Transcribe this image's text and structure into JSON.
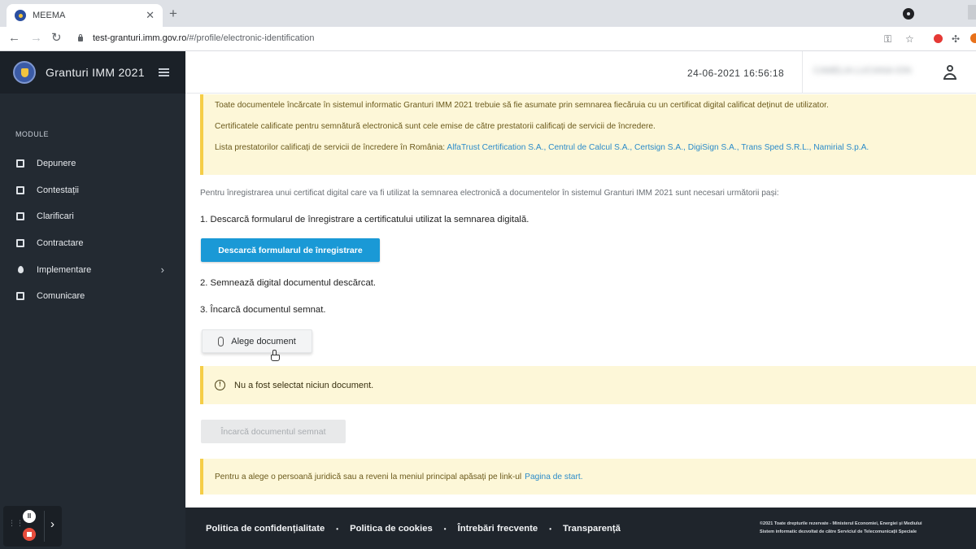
{
  "browser": {
    "tab_title": "MEEMA",
    "tab_close": "✕",
    "new_tab": "+",
    "url_host": "test-granturi.imm.gov.ro",
    "url_path": "/#/profile/electronic-identification",
    "back": "←",
    "forward": "→",
    "reload": "↻"
  },
  "sidebar": {
    "app_name": "Granturi IMM 2021",
    "section_label": "MODULE",
    "items": [
      {
        "label": "Depunere",
        "icon": "inbox-icon"
      },
      {
        "label": "Contestații",
        "icon": "document-icon"
      },
      {
        "label": "Clarificari",
        "icon": "chat-icon"
      },
      {
        "label": "Contractare",
        "icon": "copy-icon"
      },
      {
        "label": "Implementare",
        "icon": "drop-icon",
        "has_submenu": true,
        "chevron": "›"
      },
      {
        "label": "Comunicare",
        "icon": "message-icon"
      }
    ]
  },
  "header": {
    "datetime": "24-06-2021 16:56:18",
    "username": "CAMELIA LUCIANA IONESCU"
  },
  "main": {
    "notice_lines": [
      "Toate documentele încărcate în sistemul informatic Granturi IMM 2021 trebuie să fie asumate prin semnarea fiecăruia cu un certificat digital calificat deținut de utilizator.",
      "Certificatele calificate pentru semnătură electronică sunt cele emise de către prestatorii calificați de servicii de încredere."
    ],
    "providers_prefix": "Lista prestatorilor calificați de servicii de încredere în România:",
    "providers": "AlfaTrust Certification S.A., Centrul de Calcul S.A., Certsign S.A., DigiSign S.A., Trans Sped S.R.L., Namirial S.p.A.",
    "intro": "Pentru înregistrarea unui certificat digital care va fi utilizat la semnarea electronică a documentelor în sistemul Granturi IMM 2021 sunt necesari următorii pași:",
    "step1": "1. Descarcă formularul de înregistrare a certificatului utilizat la semnarea digitală.",
    "download_button": "Descarcă formularul de înregistrare",
    "step2": "2. Semnează digital documentul descărcat.",
    "step3": "3. Încarcă documentul semnat.",
    "choose_button": "Alege document",
    "warning_symbol": "!",
    "warning": "Nu a fost selectat niciun document.",
    "upload_button": "Încarcă documentul semnat",
    "bottom_notice": "Pentru a alege o persoană juridică sau a reveni la meniul principal apăsați pe link-ul",
    "bottom_link": "Pagina de start."
  },
  "footer": {
    "links": [
      "Politica de confidențialitate",
      "Politica de cookies",
      "Întrebări frecvente",
      "Transparență"
    ],
    "separator": "•",
    "copyright_1": "©2021 Toate drepturile rezervate - Ministerul Economiei, Energiei și Mediului",
    "copyright_2": "Sistem informatic dezvoltat de către Serviciul de Telecomunicații Speciale"
  },
  "recorder": {
    "pause": "II",
    "expand": "›",
    "grip": "⋮⋮"
  }
}
